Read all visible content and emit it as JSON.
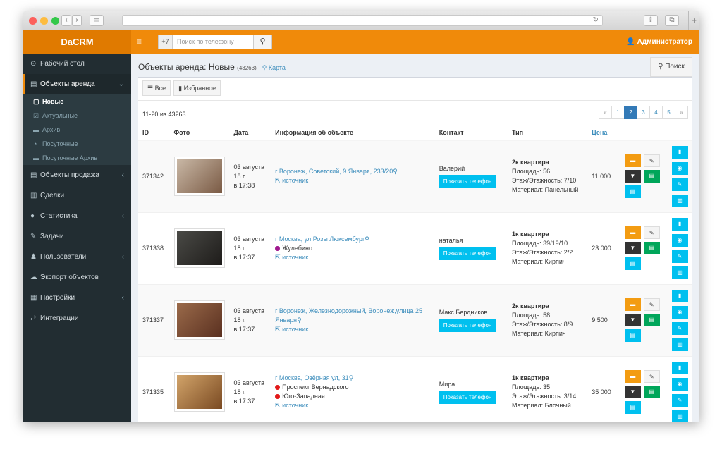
{
  "header": {
    "logo": "DaCRM",
    "menu_icon": "≡",
    "phone_prefix": "+7",
    "search_placeholder": "Поиск по телефону",
    "search_icon": "⚲",
    "user": "Администратор",
    "user_icon": "👤"
  },
  "sidebar": {
    "items": [
      {
        "label": "Рабочий стол",
        "icon": "⊙"
      },
      {
        "label": "Объекты аренда",
        "icon": "▤",
        "open": true
      },
      {
        "label": "Объекты продажа",
        "icon": "▤"
      },
      {
        "label": "Сделки",
        "icon": "▥"
      },
      {
        "label": "Статистика",
        "icon": "●"
      },
      {
        "label": "Задачи",
        "icon": "✎"
      },
      {
        "label": "Пользователи",
        "icon": "♟"
      },
      {
        "label": "Экспорт объектов",
        "icon": "☁"
      },
      {
        "label": "Настройки",
        "icon": "▦"
      },
      {
        "label": "Интеграции",
        "icon": "⇄"
      }
    ],
    "sub": [
      {
        "label": "Новые",
        "icon": "▢"
      },
      {
        "label": "Актуальные",
        "icon": "☑"
      },
      {
        "label": "Архив",
        "icon": "▬"
      },
      {
        "label": "Посуточные",
        "icon": "◔"
      },
      {
        "label": "Посуточные Архив",
        "icon": "▬"
      }
    ]
  },
  "page": {
    "title": "Объекты аренда: Новые",
    "count": "(43263)",
    "map": "Карта",
    "search_btn": "Поиск",
    "btn_all": "Все",
    "btn_fav": "Избранное",
    "info": "11-20 из 43263",
    "pages": [
      "«",
      "1",
      "2",
      "3",
      "4",
      "5",
      "»"
    ],
    "active_page": "2"
  },
  "columns": [
    "ID",
    "Фото",
    "Дата",
    "Информация об объекте",
    "Контакт",
    "Тип",
    "Цена"
  ],
  "show_phone": "Показать телефон",
  "rows": [
    {
      "id": "371342",
      "date": [
        "03 августа",
        "18 г.",
        "в 17:38"
      ],
      "addr": "г Воронеж, Советский, 9 Января, 233/20",
      "metro": [],
      "src": "источник",
      "contact": "Валерий",
      "type": "2к квартира",
      "area": "Площадь: 56",
      "floor": "Этаж/Этажность: 7/10",
      "mat": "Материал: Панельный",
      "price": "11 000",
      "photo": [
        "#c9b8a6",
        "#7a5a44"
      ]
    },
    {
      "id": "371338",
      "date": [
        "03 августа",
        "18 г.",
        "в 17:37"
      ],
      "addr": "г Москва, ул Розы Люксембург",
      "metro": [
        {
          "name": "Жулебино",
          "color": "#a0198f"
        }
      ],
      "src": "источник",
      "contact": "наталья",
      "type": "1к квартира",
      "area": "Площадь: 39/19/10",
      "floor": "Этаж/Этажность: 2/2",
      "mat": "Материал: Кирпич",
      "price": "23 000",
      "photo": [
        "#4a4a46",
        "#1e1c1a"
      ]
    },
    {
      "id": "371337",
      "date": [
        "03 августа",
        "18 г.",
        "в 17:37"
      ],
      "addr": "г Воронеж, Железнодорожный, Воронеж,улица 25 Января",
      "metro": [],
      "src": "источник",
      "contact": "Макс Бердников",
      "type": "2к квартира",
      "area": "Площадь: 58",
      "floor": "Этаж/Этажность: 8/9",
      "mat": "Материал: Кирпич",
      "price": "9 500",
      "photo": [
        "#9a6a4a",
        "#5a3020"
      ]
    },
    {
      "id": "371335",
      "date": [
        "03 августа",
        "18 г.",
        "в 17:37"
      ],
      "addr": "г Москва, Озёрная ул, 31",
      "metro": [
        {
          "name": "Проспект Вернадского",
          "color": "#e21a1a"
        },
        {
          "name": "Юго-Западная",
          "color": "#e21a1a"
        }
      ],
      "src": "источник",
      "contact": "Мира",
      "type": "1к квартира",
      "area": "Площадь: 35",
      "floor": "Этаж/Этажность: 3/14",
      "mat": "Материал: Блочный",
      "price": "35 000",
      "photo": [
        "#d2a46a",
        "#7a4a22"
      ]
    }
  ],
  "colors": {
    "orange": "#f08a0a",
    "dark": "#222d32",
    "blue": "#00c0ef",
    "green": "#00a65a"
  }
}
